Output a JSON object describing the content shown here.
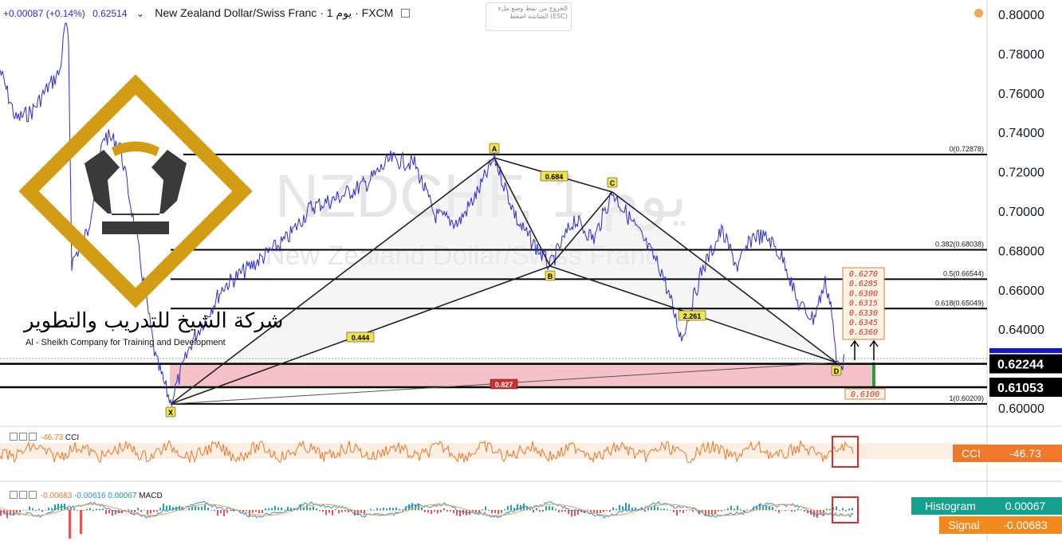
{
  "header": {
    "change": "+0.00087 (+0.14%)",
    "last": "0.62514",
    "symbol": "New Zealand Dollar/Swiss Franc · 1 يوم · FXCM"
  },
  "esc_tip": "الخروج من نمط وضع ملء الشاشة اضغط (ESC)",
  "watermark": {
    "ticker": "NZDCHF, 1 يوم",
    "name": "New Zealand Dollar/Swiss Franc"
  },
  "logo": {
    "arabic": "شركة الشيخ للتدريب والتطوير",
    "english": "Al - Sheikh Company for Training and Development"
  },
  "colors": {
    "price_line": "#2a2ae0",
    "cci": "#f0782a",
    "macd": "#2a8ef0",
    "signal": "#f0a050",
    "zone": "#f4b7bf",
    "logo_gold": "#d29c14"
  },
  "chart_data": {
    "type": "line",
    "ylim": [
      0.593,
      0.805
    ],
    "y_ticks": [
      "0.80000",
      "0.78000",
      "0.76000",
      "0.74000",
      "0.72000",
      "0.70000",
      "0.68000",
      "0.66000",
      "0.64000",
      "0.62000",
      "0.60000"
    ],
    "y_tick_values": [
      0.8,
      0.78,
      0.76,
      0.74,
      0.72,
      0.7,
      0.68,
      0.66,
      0.64,
      0.62,
      0.6
    ],
    "price_labels": [
      {
        "text": "0.62244",
        "value": 0.62244
      },
      {
        "text": "0.61053",
        "value": 0.61053
      }
    ],
    "fib_levels": [
      {
        "label": "0(0.72878)",
        "value": 0.72878
      },
      {
        "label": "0.382(0.68038)",
        "value": 0.68038
      },
      {
        "label": "0.5(0.66544)",
        "value": 0.66544
      },
      {
        "label": "0.618(0.65049)",
        "value": 0.65049
      },
      {
        "label": "1(0.60209)",
        "value": 0.60209
      }
    ],
    "pattern_points": [
      {
        "name": "X",
        "value": 0.6021
      },
      {
        "name": "A",
        "value": 0.7286
      },
      {
        "name": "B",
        "value": 0.672
      },
      {
        "name": "C",
        "value": 0.71
      },
      {
        "name": "D",
        "value": 0.6224
      }
    ],
    "ratios": [
      "0.684",
      "0.444",
      "2.261",
      "0.827"
    ],
    "target_box": [
      "0.6270",
      "0.6285",
      "0.6300",
      "0.6315",
      "0.6330",
      "0.6345",
      "0.6360"
    ],
    "stop_label": "0.6100",
    "indicators": {
      "cci": {
        "name": "CCI",
        "value": "-46.73",
        "header_value": "-46.73"
      },
      "macd": {
        "name": "MACD",
        "header_values": [
          "-0.00683",
          "-0.00616",
          "0.00067"
        ],
        "histogram_label": "Histogram",
        "histogram_value": "0.00067",
        "signal_label": "Signal",
        "signal_value": "-0.00683"
      }
    }
  }
}
